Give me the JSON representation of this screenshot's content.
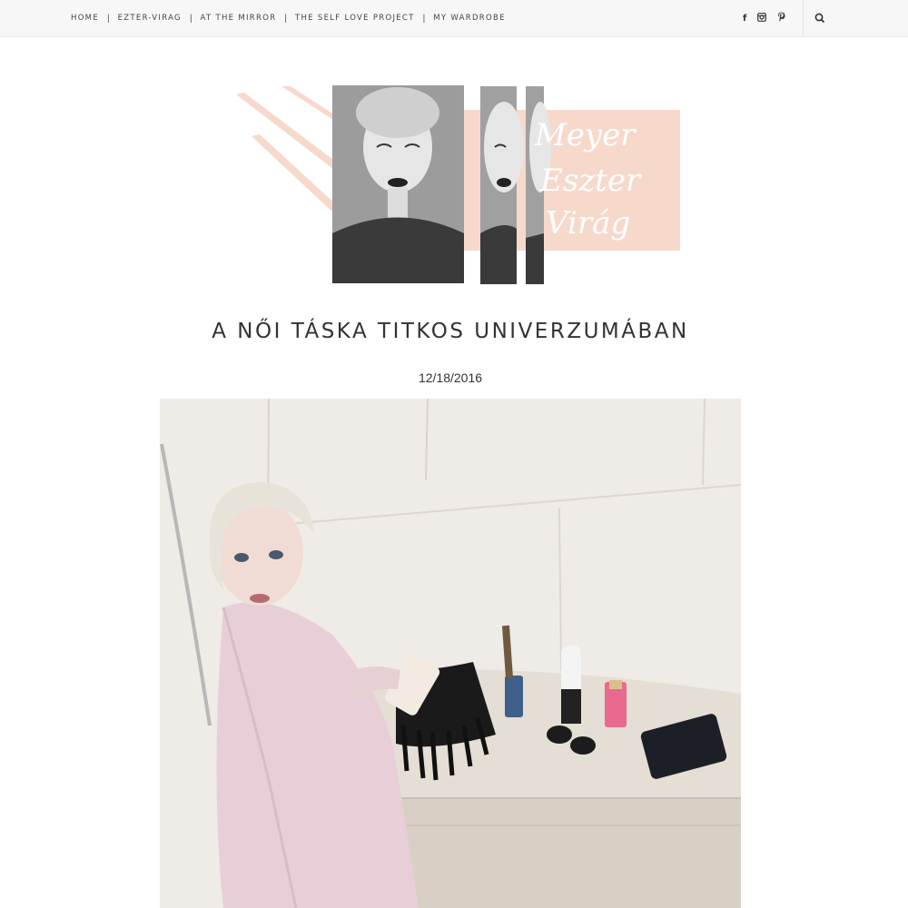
{
  "nav": {
    "items": [
      "HOME",
      "EZTER-VIRAG",
      "AT THE MIRROR",
      "THE SELF LOVE PROJECT",
      "MY WARDROBE"
    ],
    "separator": "|"
  },
  "social": {
    "facebook": "f",
    "instagram": "ig",
    "pinterest": "p"
  },
  "icons": {
    "facebook": "facebook-icon",
    "instagram": "instagram-icon",
    "pinterest": "pinterest-icon",
    "search": "search-icon"
  },
  "logo": {
    "script_text": [
      "Meyer",
      "Eszter",
      "Virág"
    ],
    "accent_color": "#f7d9cc"
  },
  "post": {
    "title": "A NŐI TÁSKA TITKOS UNIVERZUMÁBAN",
    "date": "12/18/2016"
  }
}
